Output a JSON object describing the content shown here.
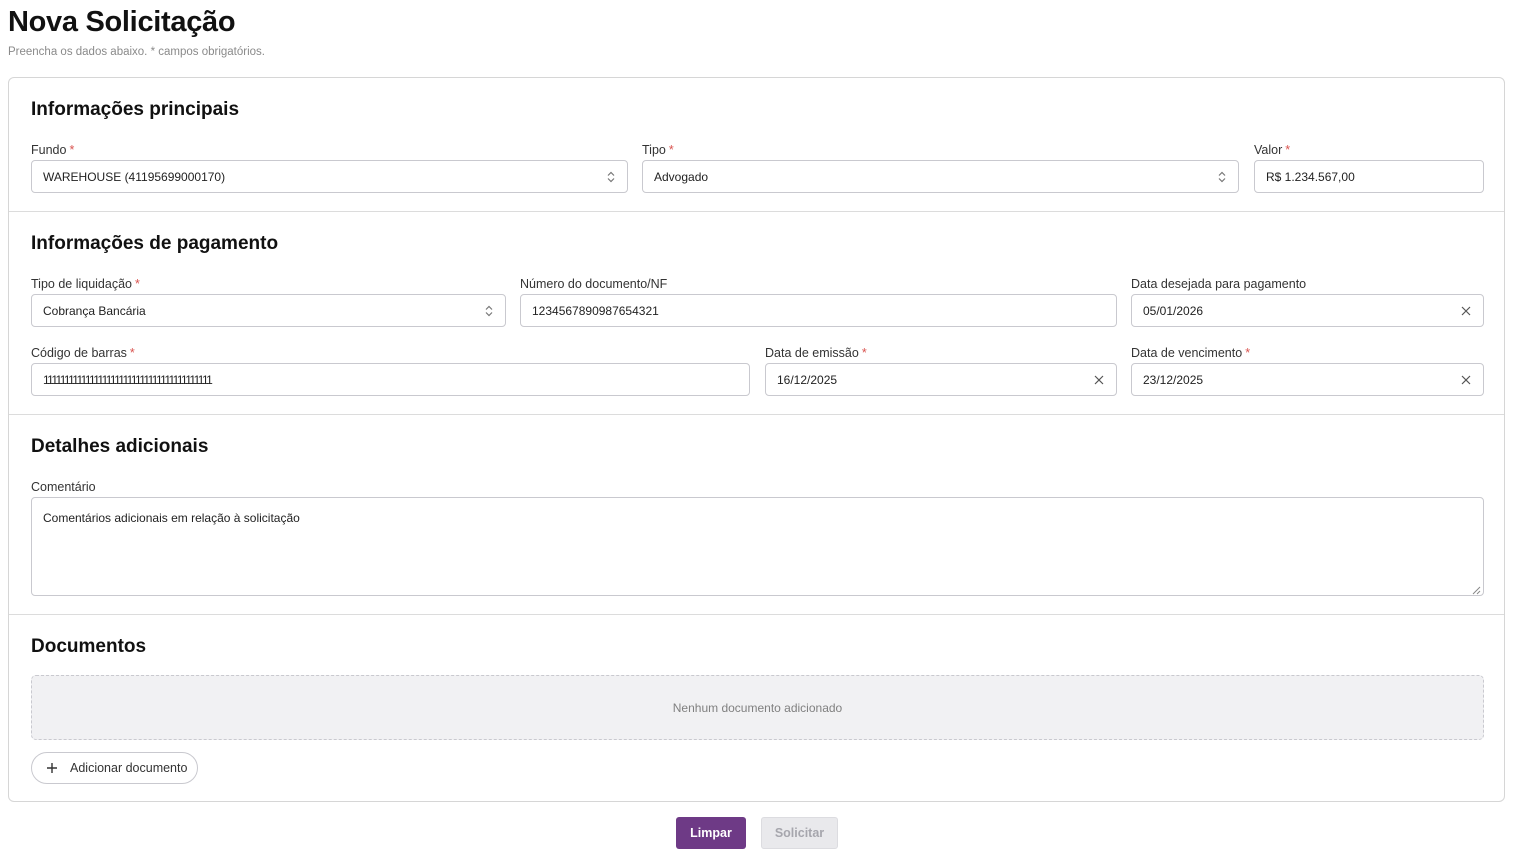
{
  "header": {
    "title": "Nova Solicitação",
    "subtitle": "Preencha os dados abaixo. * campos obrigatórios."
  },
  "sections": {
    "main": {
      "title": "Informações principais",
      "fundo": {
        "label": "Fundo",
        "required_mark": "*",
        "value": "WAREHOUSE (41195699000170)"
      },
      "tipo": {
        "label": "Tipo",
        "required_mark": "*",
        "value": "Advogado"
      },
      "valor": {
        "label": "Valor",
        "required_mark": "*",
        "value": "R$ 1.234.567,00"
      }
    },
    "payment": {
      "title": "Informações de pagamento",
      "tipo_liquidacao": {
        "label": "Tipo de liquidação",
        "required_mark": "*",
        "value": "Cobrança Bancária"
      },
      "numero_documento": {
        "label": "Número do documento/NF",
        "value": "1234567890987654321"
      },
      "data_desejada": {
        "label": "Data desejada para pagamento",
        "value": "05/01/2026"
      },
      "codigo_barras": {
        "label": "Código de barras",
        "required_mark": "*",
        "value": "1111111111111111111111111111111111111111"
      },
      "data_emissao": {
        "label": "Data de emissão",
        "required_mark": "*",
        "value": "16/12/2025"
      },
      "data_vencimento": {
        "label": "Data de vencimento",
        "required_mark": "*",
        "value": "23/12/2025"
      }
    },
    "details": {
      "title": "Detalhes adicionais",
      "comentario": {
        "label": "Comentário",
        "value": "Comentários adicionais em relação à solicitação"
      }
    },
    "documents": {
      "title": "Documentos",
      "empty_text": "Nenhum documento adicionado",
      "add_label": "Adicionar documento"
    }
  },
  "actions": {
    "clear_label": "Limpar",
    "submit_label": "Solicitar"
  },
  "colors": {
    "primary": "#6e3a86",
    "required": "#d9534f",
    "disabled_bg": "#e9e9ec"
  },
  "icons": {
    "select": "chevron-updown-icon",
    "clear": "close-icon",
    "add": "plus-icon"
  }
}
